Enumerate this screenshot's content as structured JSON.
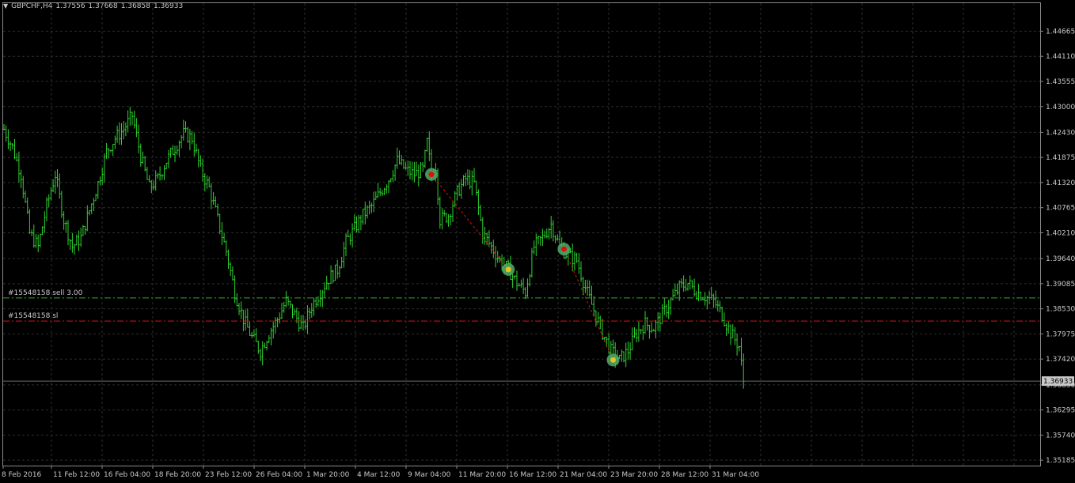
{
  "header": {
    "symbol": "GBPCHF,H4",
    "open": "1.37556",
    "high": "1.37668",
    "low": "1.36858",
    "close": "1.36933"
  },
  "colors": {
    "background": "#000000",
    "bars": "#2ed32e",
    "grid": "#2a2f2a",
    "axis_text": "#c8c8c8",
    "entry_line": "#2fa52f",
    "sl_line": "#e01010",
    "trade_path": "#e01010",
    "price_marker_bg": "#c8c8c8"
  },
  "orders": {
    "entry_label": "#15548158 sell 3.00",
    "sl_label": "#15548158 sl"
  },
  "current_price": "1.36933",
  "chart_data": {
    "type": "ohlc",
    "symbol": "GBPCHF",
    "timeframe": "H4",
    "y_ticks": [
      "1.44665",
      "1.44110",
      "1.43555",
      "1.43000",
      "1.42430",
      "1.41875",
      "1.41320",
      "1.40765",
      "1.40210",
      "1.39640",
      "1.39085",
      "1.38530",
      "1.37975",
      "1.37420",
      "1.36850",
      "1.36295",
      "1.35740",
      "1.35185"
    ],
    "x_ticks": [
      "8 Feb 2016",
      "11 Feb 12:00",
      "16 Feb 04:00",
      "18 Feb 20:00",
      "23 Feb 12:00",
      "26 Feb 04:00",
      "1 Mar 20:00",
      "4 Mar 12:00",
      "9 Mar 04:00",
      "11 Mar 20:00",
      "16 Mar 12:00",
      "21 Mar 04:00",
      "23 Mar 20:00",
      "28 Mar 12:00",
      "31 Mar 04:00"
    ],
    "ylim": [
      1.351,
      1.449
    ],
    "entry_price": 1.3877,
    "sl_price": 1.3826,
    "close_path": [
      [
        0,
        1.425
      ],
      [
        4,
        1.421
      ],
      [
        8,
        1.415
      ],
      [
        12,
        1.402
      ],
      [
        16,
        1.399
      ],
      [
        20,
        1.408
      ],
      [
        24,
        1.415
      ],
      [
        28,
        1.405
      ],
      [
        32,
        1.399
      ],
      [
        36,
        1.401
      ],
      [
        40,
        1.407
      ],
      [
        44,
        1.413
      ],
      [
        48,
        1.42
      ],
      [
        52,
        1.423
      ],
      [
        56,
        1.425
      ],
      [
        60,
        1.428
      ],
      [
        64,
        1.419
      ],
      [
        68,
        1.412
      ],
      [
        72,
        1.414
      ],
      [
        76,
        1.418
      ],
      [
        80,
        1.421
      ],
      [
        84,
        1.424
      ],
      [
        88,
        1.423
      ],
      [
        92,
        1.416
      ],
      [
        96,
        1.412
      ],
      [
        100,
        1.405
      ],
      [
        104,
        1.398
      ],
      [
        108,
        1.389
      ],
      [
        112,
        1.383
      ],
      [
        116,
        1.379
      ],
      [
        120,
        1.376
      ],
      [
        124,
        1.38
      ],
      [
        128,
        1.383
      ],
      [
        132,
        1.387
      ],
      [
        136,
        1.384
      ],
      [
        140,
        1.381
      ],
      [
        144,
        1.386
      ],
      [
        148,
        1.389
      ],
      [
        152,
        1.392
      ],
      [
        156,
        1.394
      ],
      [
        160,
        1.4
      ],
      [
        164,
        1.403
      ],
      [
        168,
        1.406
      ],
      [
        172,
        1.408
      ],
      [
        176,
        1.411
      ],
      [
        180,
        1.414
      ],
      [
        184,
        1.418
      ],
      [
        188,
        1.416
      ],
      [
        192,
        1.415
      ],
      [
        196,
        1.416
      ],
      [
        198,
        1.422
      ],
      [
        200,
        1.415
      ],
      [
        202,
        1.417
      ],
      [
        204,
        1.405
      ],
      [
        208,
        1.406
      ],
      [
        212,
        1.411
      ],
      [
        216,
        1.414
      ],
      [
        220,
        1.413
      ],
      [
        224,
        1.402
      ],
      [
        228,
        1.399
      ],
      [
        232,
        1.396
      ],
      [
        236,
        1.394
      ],
      [
        240,
        1.391
      ],
      [
        244,
        1.389
      ],
      [
        248,
        1.399
      ],
      [
        252,
        1.401
      ],
      [
        256,
        1.404
      ],
      [
        260,
        1.399
      ],
      [
        264,
        1.397
      ],
      [
        268,
        1.396
      ],
      [
        272,
        1.39
      ],
      [
        276,
        1.385
      ],
      [
        280,
        1.38
      ],
      [
        284,
        1.376
      ],
      [
        288,
        1.374
      ],
      [
        292,
        1.376
      ],
      [
        296,
        1.38
      ],
      [
        300,
        1.382
      ],
      [
        304,
        1.381
      ],
      [
        308,
        1.384
      ],
      [
        312,
        1.387
      ],
      [
        316,
        1.39
      ],
      [
        320,
        1.391
      ],
      [
        324,
        1.389
      ],
      [
        328,
        1.388
      ],
      [
        332,
        1.387
      ],
      [
        336,
        1.384
      ],
      [
        340,
        1.38
      ],
      [
        344,
        1.377
      ],
      [
        346,
        1.3693
      ]
    ],
    "trades": [
      {
        "kind": "sell",
        "bar": 200,
        "price": 1.415
      },
      {
        "kind": "close",
        "bar": 236,
        "price": 1.394
      },
      {
        "kind": "sell",
        "bar": 262,
        "price": 1.3985
      },
      {
        "kind": "close",
        "bar": 285,
        "price": 1.374
      }
    ]
  }
}
